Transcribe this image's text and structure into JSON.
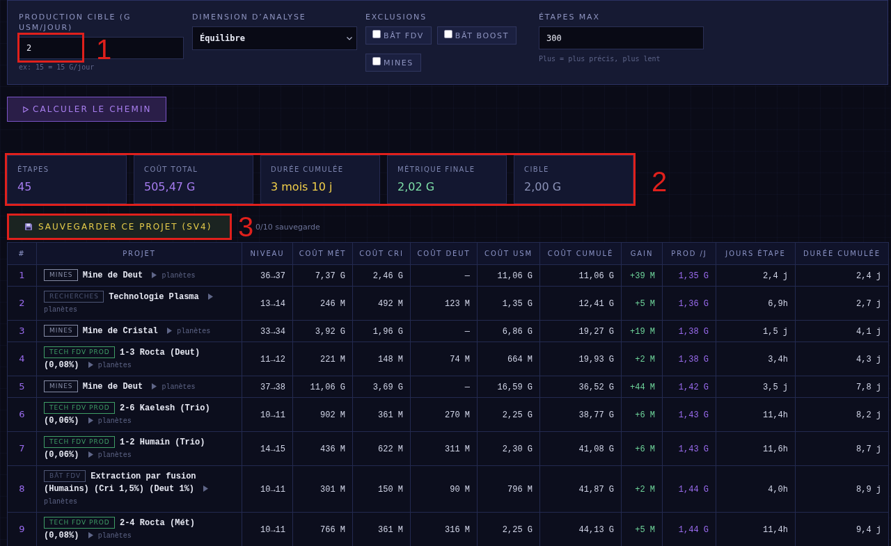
{
  "form": {
    "production": {
      "label": "PRODUCTION CIBLE (G USM/JOUR)",
      "value": "2",
      "hint": "ex: 15 = 15 G/jour",
      "callout": "1"
    },
    "dimension": {
      "label": "DIMENSION D’ANALYSE",
      "value": "Équilibre"
    },
    "exclusions": {
      "label": "EXCLUSIONS",
      "options": [
        {
          "label": "BÂT FDV",
          "checked": false
        },
        {
          "label": "BÂT BOOST",
          "checked": false
        },
        {
          "label": "MINES",
          "checked": false
        }
      ]
    },
    "max_steps": {
      "label": "ÉTAPES MAX",
      "value": "300",
      "hint": "Plus = plus précis, plus lent"
    }
  },
  "calculate_button": {
    "label": "CALCULER LE CHEMIN"
  },
  "stats": {
    "callout": "2",
    "items": [
      {
        "label": "ÉTAPES",
        "value": "45",
        "color": "#a67cf0"
      },
      {
        "label": "COÛT TOTAL",
        "value": "505,47 G",
        "color": "#a67cf0"
      },
      {
        "label": "DURÉE CUMULÉE",
        "value": "3 mois 10 j",
        "color": "#f2d04a"
      },
      {
        "label": "MÉTRIQUE FINALE",
        "value": "2,02 G",
        "color": "#7ee0a8"
      },
      {
        "label": "CIBLE",
        "value": "2,00 G",
        "color": "#8c93b8"
      }
    ]
  },
  "save": {
    "button": "SAUVEGARDER CE PROJET (SV4)",
    "status": "0/10 sauvegarde",
    "callout": "3"
  },
  "table": {
    "columns": [
      "#",
      "PROJET",
      "NIVEAU",
      "COÛT MÉT",
      "COÛT CRI",
      "COÛT DEUT",
      "COÛT USM",
      "COÛT CUMULÉ",
      "GAIN",
      "PROD /J",
      "JOURS ÉTAPE",
      "DURÉE CUMULÉE"
    ],
    "rows": [
      {
        "num": "1",
        "tag": {
          "label": "MINES",
          "color": "#868ca6"
        },
        "name": "Mine de Deut",
        "planets": "planètes",
        "niveau": "36→37",
        "cost_met": "7,37 G",
        "cost_cri": "2,46 G",
        "cost_deut": "—",
        "cost_usm": "11,06 G",
        "cost_cumul": "11,06 G",
        "gain": "+39 M",
        "prod_day": "1,35 G",
        "step_days": "2,4 j",
        "duration_cumul": "2,4 j"
      },
      {
        "num": "2",
        "tag": {
          "label": "RECHERCHES",
          "color": "#4e5676"
        },
        "name": "Technologie Plasma",
        "planets": "planètes",
        "niveau": "13→14",
        "cost_met": "246 M",
        "cost_cri": "492 M",
        "cost_deut": "123 M",
        "cost_usm": "1,35 G",
        "cost_cumul": "12,41 G",
        "gain": "+5 M",
        "prod_day": "1,36 G",
        "step_days": "6,9h",
        "duration_cumul": "2,7 j"
      },
      {
        "num": "3",
        "tag": {
          "label": "MINES",
          "color": "#868ca6"
        },
        "name": "Mine de Cristal",
        "planets": "planètes",
        "niveau": "33→34",
        "cost_met": "3,92 G",
        "cost_cri": "1,96 G",
        "cost_deut": "—",
        "cost_usm": "6,86 G",
        "cost_cumul": "19,27 G",
        "gain": "+19 M",
        "prod_day": "1,38 G",
        "step_days": "1,5 j",
        "duration_cumul": "4,1 j"
      },
      {
        "num": "4",
        "tag": {
          "label": "TECH FDV PROD",
          "color": "#3f9e66"
        },
        "name": "1-3 Rocta (Deut)",
        "detail": "(0,08%)",
        "planets": "planètes",
        "niveau": "11→12",
        "cost_met": "221 M",
        "cost_cri": "148 M",
        "cost_deut": "74 M",
        "cost_usm": "664 M",
        "cost_cumul": "19,93 G",
        "gain": "+2 M",
        "prod_day": "1,38 G",
        "step_days": "3,4h",
        "duration_cumul": "4,3 j"
      },
      {
        "num": "5",
        "tag": {
          "label": "MINES",
          "color": "#868ca6"
        },
        "name": "Mine de Deut",
        "planets": "planètes",
        "niveau": "37→38",
        "cost_met": "11,06 G",
        "cost_cri": "3,69 G",
        "cost_deut": "—",
        "cost_usm": "16,59 G",
        "cost_cumul": "36,52 G",
        "gain": "+44 M",
        "prod_day": "1,42 G",
        "step_days": "3,5 j",
        "duration_cumul": "7,8 j"
      },
      {
        "num": "6",
        "tag": {
          "label": "TECH FDV PROD",
          "color": "#3f9e66"
        },
        "name": "2-6 Kaelesh (Trio)",
        "detail": "(0,06%)",
        "planets": "planètes",
        "niveau": "10→11",
        "cost_met": "902 M",
        "cost_cri": "361 M",
        "cost_deut": "270 M",
        "cost_usm": "2,25 G",
        "cost_cumul": "38,77 G",
        "gain": "+6 M",
        "prod_day": "1,43 G",
        "step_days": "11,4h",
        "duration_cumul": "8,2 j"
      },
      {
        "num": "7",
        "tag": {
          "label": "TECH FDV PROD",
          "color": "#3f9e66"
        },
        "name": "1-2 Humain (Trio)",
        "detail": "(0,06%)",
        "planets": "planètes",
        "niveau": "14→15",
        "cost_met": "436 M",
        "cost_cri": "622 M",
        "cost_deut": "311 M",
        "cost_usm": "2,30 G",
        "cost_cumul": "41,08 G",
        "gain": "+6 M",
        "prod_day": "1,43 G",
        "step_days": "11,6h",
        "duration_cumul": "8,7 j"
      },
      {
        "num": "8",
        "tag": {
          "label": "BÂT FDV",
          "color": "#4e5676"
        },
        "name": "Extraction par fusion",
        "detail": "(Humains) (Cri 1,5%) (Deut 1%)",
        "planets": "planètes",
        "niveau": "10→11",
        "cost_met": "301 M",
        "cost_cri": "150 M",
        "cost_deut": "90 M",
        "cost_usm": "796 M",
        "cost_cumul": "41,87 G",
        "gain": "+2 M",
        "prod_day": "1,44 G",
        "step_days": "4,0h",
        "duration_cumul": "8,9 j"
      },
      {
        "num": "9",
        "tag": {
          "label": "TECH FDV PROD",
          "color": "#3f9e66"
        },
        "name": "2-4 Rocta (Mét)",
        "detail": "(0,08%)",
        "planets": "planètes",
        "niveau": "10→11",
        "cost_met": "766 M",
        "cost_cri": "361 M",
        "cost_deut": "316 M",
        "cost_usm": "2,25 G",
        "cost_cumul": "44,13 G",
        "gain": "+5 M",
        "prod_day": "1,44 G",
        "step_days": "11,4h",
        "duration_cumul": "9,4 j"
      }
    ]
  }
}
